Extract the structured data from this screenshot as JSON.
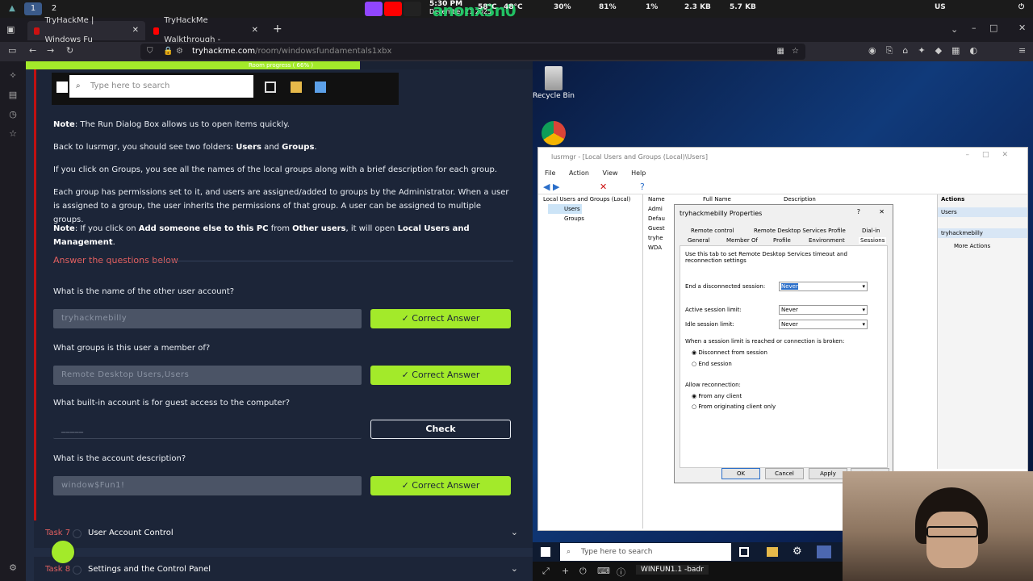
{
  "system_bar": {
    "workspaces": [
      "1",
      "2"
    ],
    "time": "5:30 PM",
    "date": "December 21 2025",
    "temp": "58°C",
    "temp2": "48°C",
    "cpu": "30%",
    "battery": "81%",
    "mem": "1%",
    "up": "2.3 KB",
    "down": "5.7 KB",
    "lang": "US",
    "handle": "anonx3n0"
  },
  "browser": {
    "tabs": [
      {
        "label": "TryHackMe | Windows Fu",
        "active": true
      },
      {
        "label": "TryHackMe Walkthrough -",
        "active": false
      }
    ],
    "url_host": "tryhackme.com",
    "url_path": "/room/windowsfundamentals1xbx",
    "colors": {
      "tabbar": "#1c1b22",
      "navbar": "#2b2a33"
    }
  },
  "room": {
    "progress_label": "Room progress ( 66% )",
    "progress": 0.66,
    "search_placeholder": "Type here to search",
    "paragraphs": [
      {
        "pre": "Note",
        "text": ": The Run Dialog Box allows us to open items quickly."
      },
      {
        "pre": "",
        "text": "Back to lusrmgr, you should see two folders: ",
        "b1": "Users",
        "mid": " and ",
        "b2": "Groups",
        "post": "."
      },
      {
        "pre": "",
        "text": "If you click on Groups, you see all the names of the local groups along with a brief description for each group."
      },
      {
        "pre": "",
        "text": "Each group has permissions set to it, and users are assigned/added to groups by the Administrator. When a user is assigned to a group, the user inherits the permissions of that group. A user can be assigned to multiple groups."
      }
    ],
    "note2": {
      "pre": "Note",
      "t1": ": If you click on ",
      "b1": "Add someone else to this PC",
      "t2": " from ",
      "b2": "Other users",
      "t3": ", it will open ",
      "b3": "Local Users and Management",
      "t4": "."
    },
    "answer_heading": "Answer the questions below",
    "questions": [
      {
        "q": "What is the name of the other user account?",
        "answer": "tryhackmebilly",
        "button": "✓ Correct Answer",
        "state": "correct"
      },
      {
        "q": "What groups is this user a member of?",
        "answer": "Remote Desktop Users,Users",
        "button": "✓ Correct Answer",
        "state": "correct"
      },
      {
        "q": "What built-in account is for guest access to the computer?",
        "answer": "_____",
        "button": "Check",
        "state": "pending"
      },
      {
        "q": "What is the account description?",
        "answer": "window$Fun1!",
        "button": "✓ Correct Answer",
        "state": "correct"
      }
    ],
    "tasks": [
      {
        "num": "Task 7",
        "title": "User Account Control"
      },
      {
        "num": "Task 8",
        "title": "Settings and the Control Panel"
      }
    ],
    "colors": {
      "accent": "#a3ea2a",
      "task_num": "#e36060",
      "bg": "#212c42"
    }
  },
  "desktop": {
    "icons": [
      {
        "label": "Recycle Bin"
      }
    ],
    "lusrmgr": {
      "title": "lusrmgr - [Local Users and Groups (Local)\\Users]",
      "menu": [
        "File",
        "Action",
        "View",
        "Help"
      ],
      "tree": [
        "Local Users and Groups (Local)",
        "Users",
        "Groups"
      ],
      "columns": [
        "Name",
        "Full Name",
        "Description"
      ],
      "rows": [
        "Admi",
        "Defau",
        "Guest",
        "tryhe",
        "WDA"
      ],
      "actions_header": "Actions",
      "actions": [
        "Users",
        "tryhackmebilly",
        "More Actions"
      ]
    },
    "dialog": {
      "title": "tryhackmebilly Properties",
      "tabs_row1": [
        "Remote control",
        "Remote Desktop Services Profile",
        "Dial-in"
      ],
      "tabs_row2": [
        "General",
        "Member Of",
        "Profile",
        "Environment",
        "Sessions"
      ],
      "intro": "Use this tab to set Remote Desktop Services timeout and reconnection settings",
      "fields": [
        {
          "label": "End a disconnected session:",
          "value": "Never"
        },
        {
          "label": "Active session limit:",
          "value": "Never"
        },
        {
          "label": "Idle session limit:",
          "value": "Never"
        }
      ],
      "limit_heading": "When a session limit is reached or connection is broken:",
      "limit_options": [
        "Disconnect from session",
        "End session"
      ],
      "reconnect_heading": "Allow reconnection:",
      "reconnect_options": [
        "From any client",
        "From originating client only"
      ],
      "buttons": [
        "OK",
        "Cancel",
        "Apply",
        "Help"
      ]
    },
    "taskbar_search": "Type here to search",
    "rdp_label": "WINFUN1.1 -badr"
  }
}
